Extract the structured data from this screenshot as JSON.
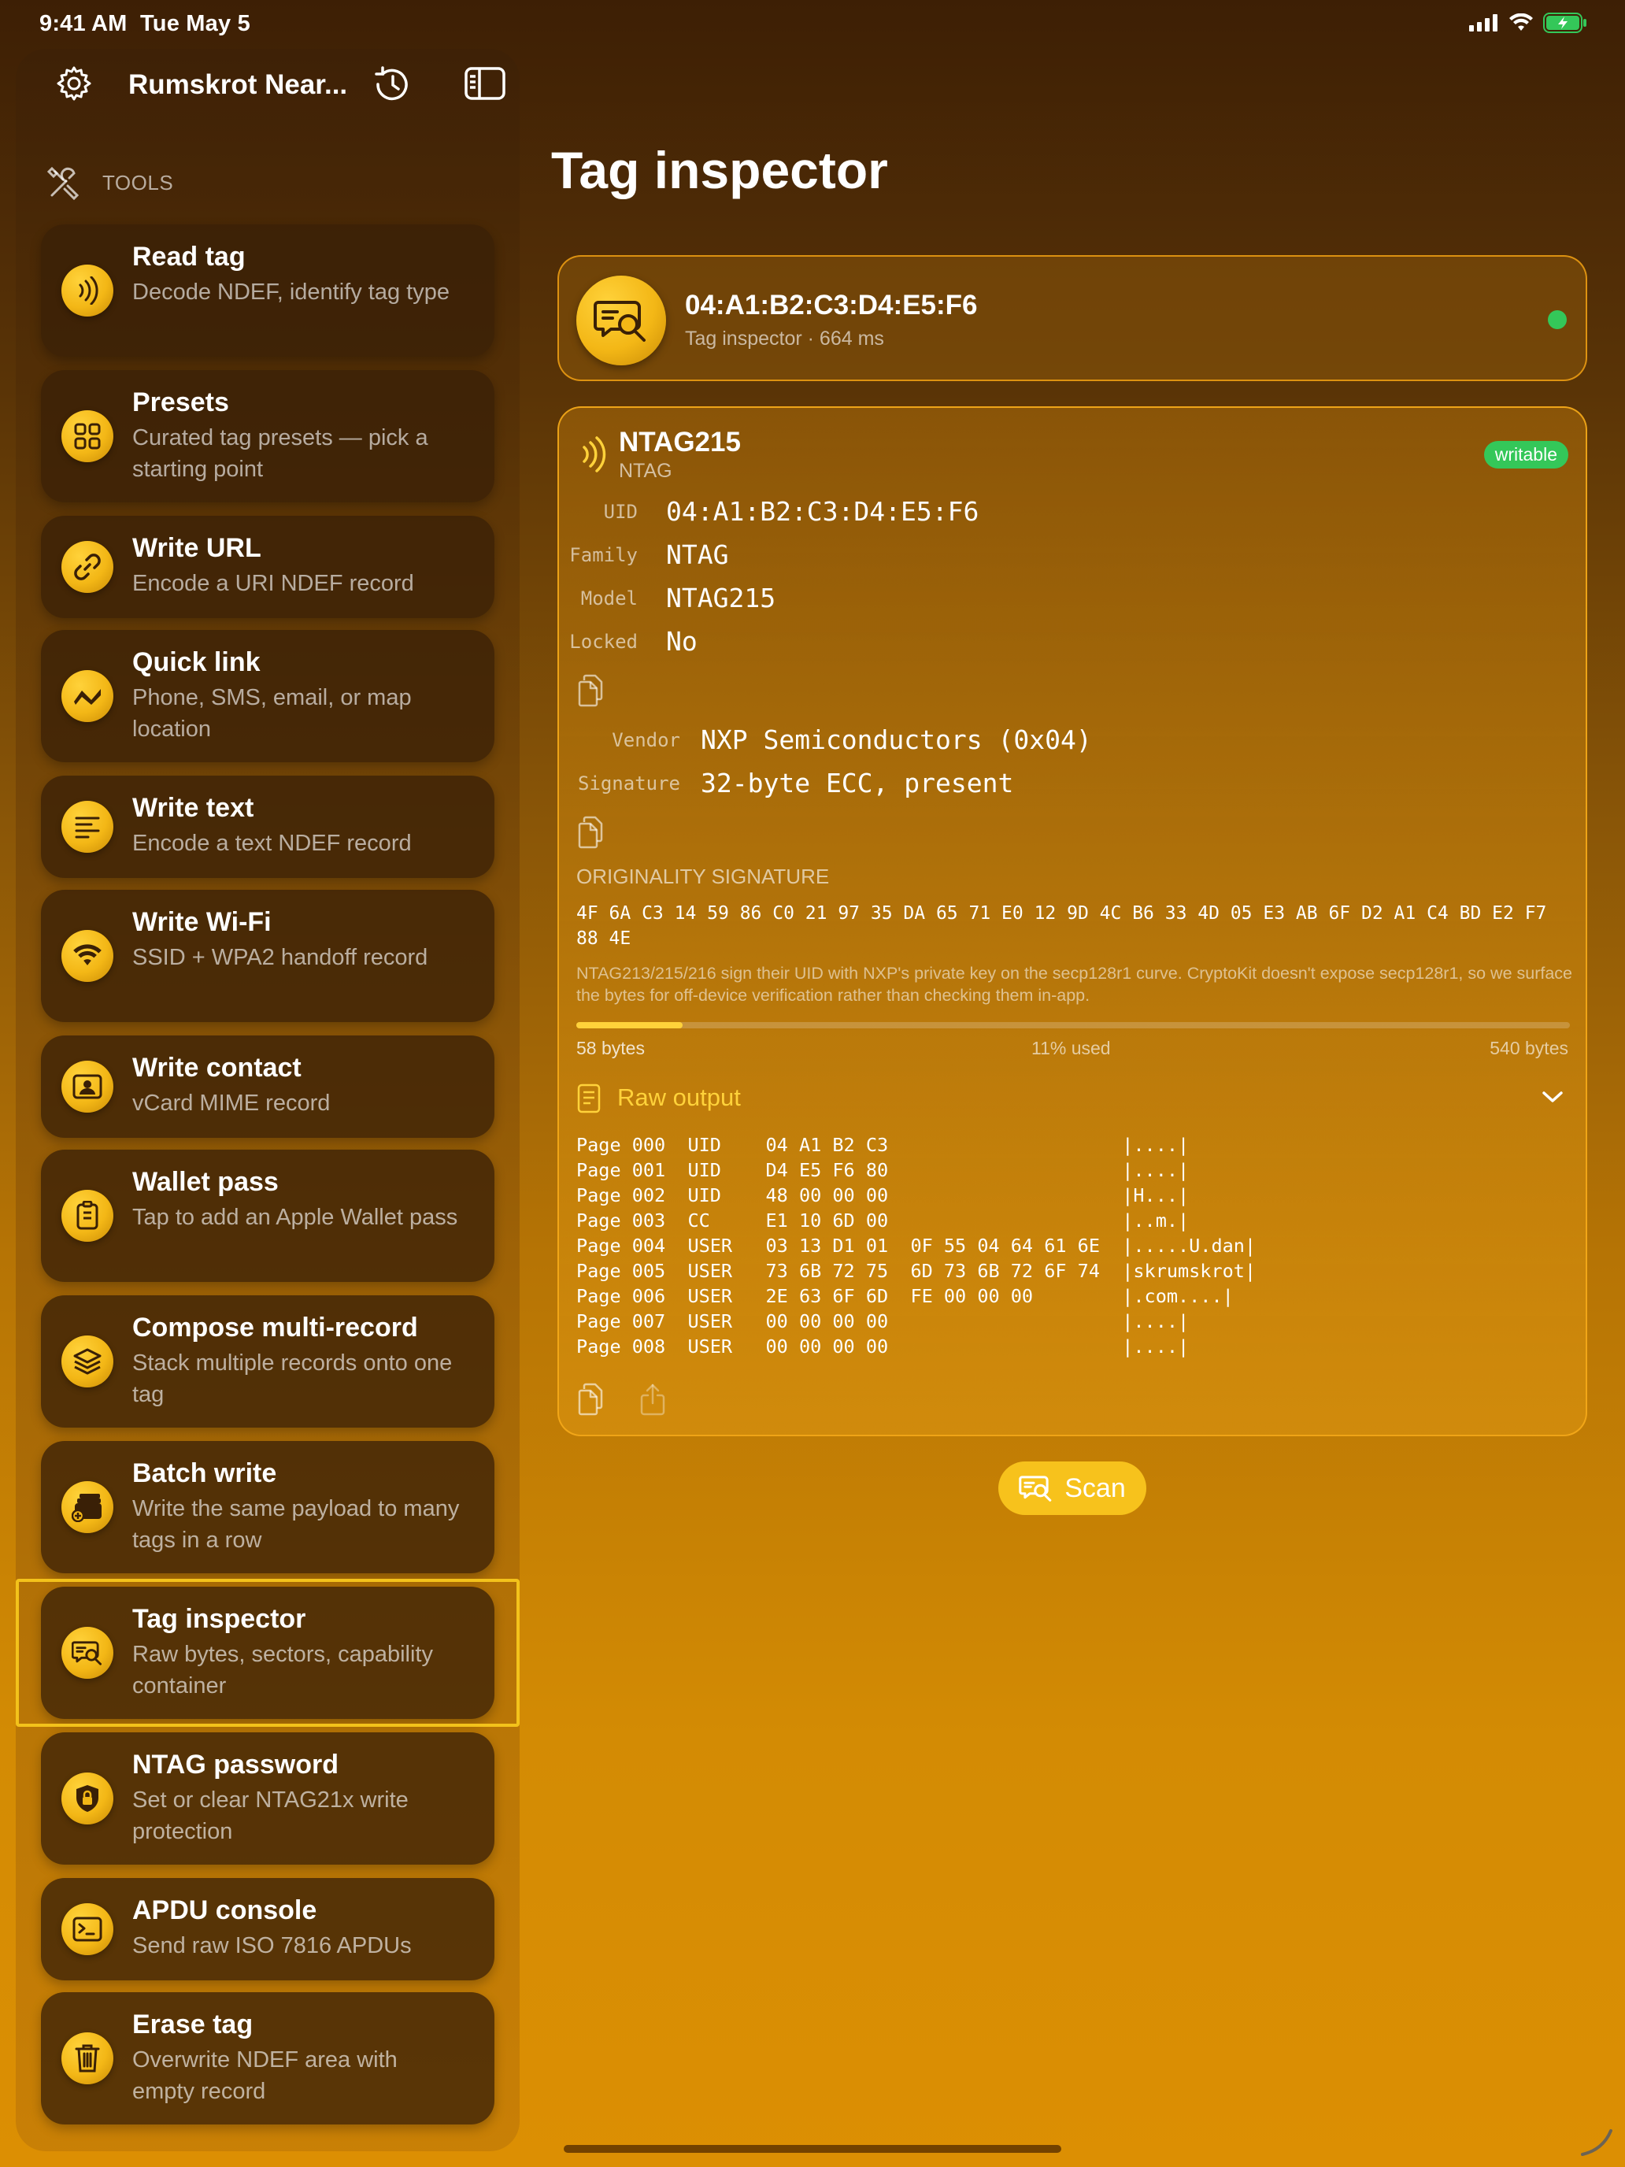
{
  "status_bar": {
    "time": "9:41 AM",
    "date": "Tue May 5"
  },
  "sidebar": {
    "title": "Rumskrot Near...",
    "section_label": "TOOLS",
    "items": [
      {
        "title": "Read tag",
        "subtitle": "Decode NDEF, identify tag type",
        "icon": "nfc-waves-icon"
      },
      {
        "title": "Presets",
        "subtitle": "Curated tag presets — pick a starting point",
        "icon": "grid-icon"
      },
      {
        "title": "Write URL",
        "subtitle": "Encode a URI NDEF record",
        "icon": "link-icon"
      },
      {
        "title": "Quick link",
        "subtitle": "Phone, SMS, email, or map location",
        "icon": "zigzag-icon"
      },
      {
        "title": "Write text",
        "subtitle": "Encode a text NDEF record",
        "icon": "text-lines-icon"
      },
      {
        "title": "Write Wi-Fi",
        "subtitle": "SSID + WPA2 handoff record",
        "icon": "wifi-icon"
      },
      {
        "title": "Write contact",
        "subtitle": "vCard MIME record",
        "icon": "contact-card-icon"
      },
      {
        "title": "Wallet pass",
        "subtitle": "Tap to add an Apple Wallet pass",
        "icon": "wallet-pass-icon"
      },
      {
        "title": "Compose multi-record",
        "subtitle": "Stack multiple records onto one tag",
        "icon": "layers-icon"
      },
      {
        "title": "Batch write",
        "subtitle": "Write the same payload to many tags in a row",
        "icon": "batch-icon"
      },
      {
        "title": "Tag inspector",
        "subtitle": "Raw bytes, sectors, capability container",
        "icon": "inspector-icon"
      },
      {
        "title": "NTAG password",
        "subtitle": "Set or clear NTAG21x write protection",
        "icon": "lock-shield-icon"
      },
      {
        "title": "APDU console",
        "subtitle": "Send raw ISO 7816 APDUs",
        "icon": "terminal-icon"
      },
      {
        "title": "Erase tag",
        "subtitle": "Overwrite NDEF area with empty record",
        "icon": "trash-icon"
      }
    ]
  },
  "main": {
    "title": "Tag inspector",
    "summary": {
      "uid": "04:A1:B2:C3:D4:E5:F6",
      "subtitle": "Tag inspector · 664 ms"
    },
    "tag": {
      "name": "NTAG215",
      "family_sub": "NTAG",
      "badge": "writable",
      "fields": [
        {
          "key": "UID",
          "value": "04:A1:B2:C3:D4:E5:F6"
        },
        {
          "key": "Family",
          "value": "NTAG"
        },
        {
          "key": "Model",
          "value": "NTAG215"
        },
        {
          "key": "Locked",
          "value": "No"
        }
      ],
      "fields2": [
        {
          "key": "Vendor",
          "value": "NXP Semiconductors (0x04)"
        },
        {
          "key": "Signature",
          "value": "32-byte ECC, present"
        }
      ],
      "sig_label": "ORIGINALITY SIGNATURE",
      "sig_hex": "4F 6A C3 14 59 86 C0 21 97 35 DA 65 71 E0 12 9D 4C B6 33 4D 05 E3 AB 6F D2 A1 C4 BD E2 F7 88 4E",
      "sig_note": "NTAG213/215/216 sign their UID with NXP's private key on the secp128r1 curve. CryptoKit doesn't expose secp128r1, so we surface the bytes for off-device verification rather than checking them in-app.",
      "usage": {
        "used": "58 bytes",
        "percent_label": "11% used",
        "total": "540 bytes",
        "fraction": 0.107
      },
      "raw_title": "Raw output",
      "raw_lines": [
        "Page 000  UID    04 A1 B2 C3                     |....|",
        "Page 001  UID    D4 E5 F6 80                     |....|",
        "Page 002  UID    48 00 00 00                     |H...|",
        "Page 003  CC     E1 10 6D 00                     |..m.|",
        "Page 004  USER   03 13 D1 01  0F 55 04 64 61 6E  |.....U.dan|",
        "Page 005  USER   73 6B 72 75  6D 73 6B 72 6F 74  |skrumskrot|",
        "Page 006  USER   2E 63 6F 6D  FE 00 00 00        |.com....|",
        "Page 007  USER   00 00 00 00                     |....|",
        "Page 008  USER   00 00 00 00                     |....|"
      ]
    },
    "scan_label": "Scan"
  },
  "colors": {
    "accent": "#f7c21c",
    "success": "#34c759",
    "card_dark": "#3a2006"
  }
}
